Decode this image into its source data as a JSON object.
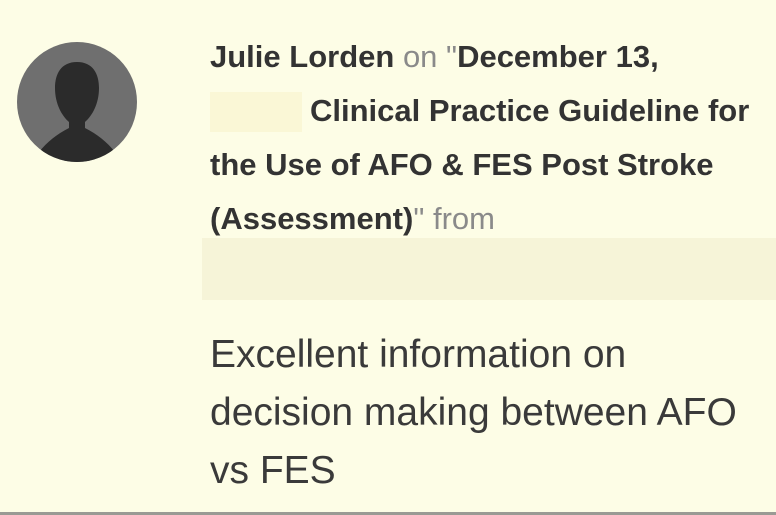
{
  "comment": {
    "author": "Julie Lorden",
    "on_label": "on",
    "quote_open": "\"",
    "article_date": "December 13,",
    "article_title": "Clinical Practice Guideline for the Use of AFO & FES Post Stroke (Assessment)",
    "quote_close": "\"",
    "from_label": "from",
    "body": "Excellent information on decision making between AFO vs FES",
    "avatar_icon": "default-user-silhouette-icon"
  },
  "colors": {
    "background": "#fdfde6",
    "avatar_bg": "#6f6f6f",
    "silhouette": "#2b2b2b",
    "muted_text": "#8a8a8a"
  }
}
